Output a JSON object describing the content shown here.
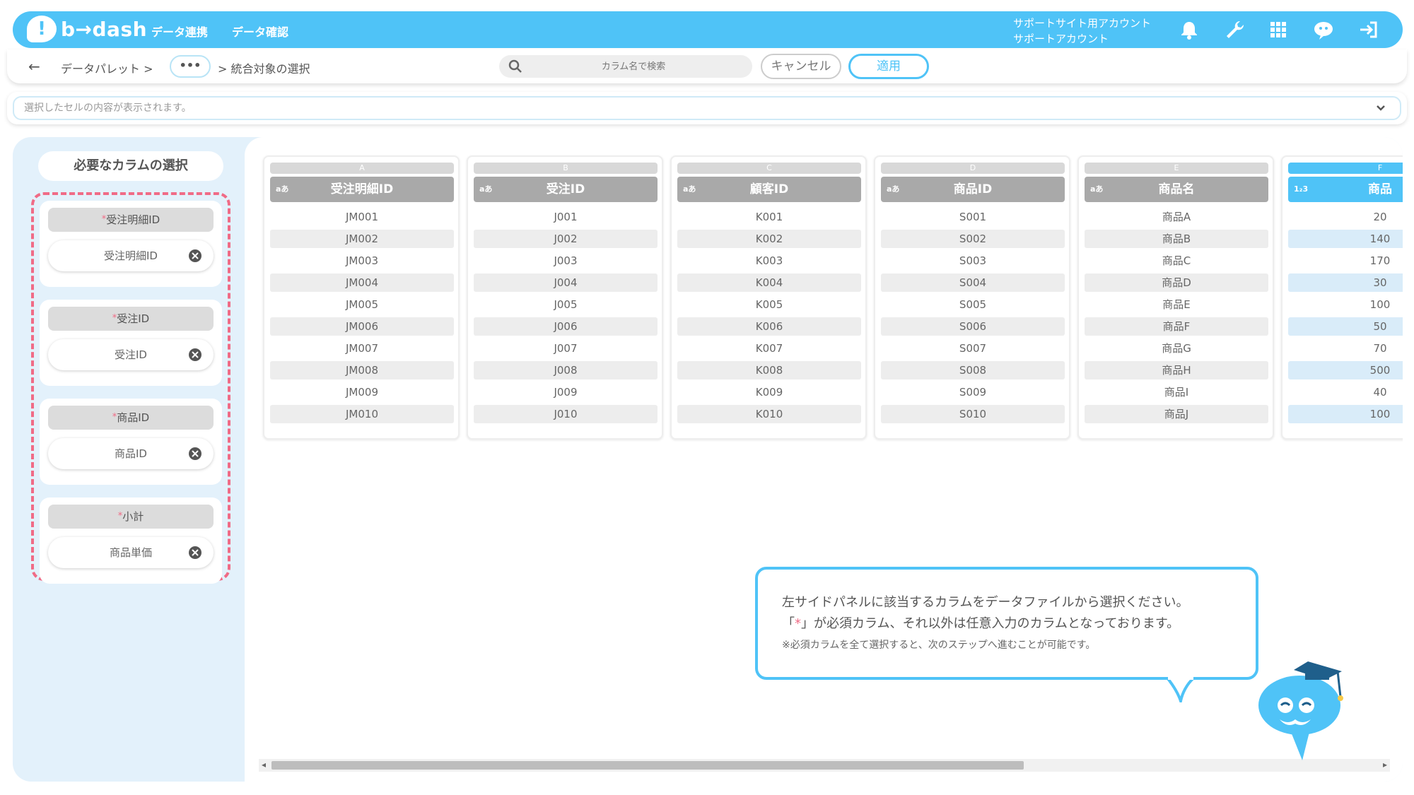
{
  "header": {
    "logo_text": "b→dash",
    "nav": [
      "データ連携",
      "データ確認"
    ],
    "account_line1": "サポートサイト用アカウント",
    "account_line2": "サポートアカウント",
    "icons": [
      "bell-icon",
      "wrench-icon",
      "apps-grid-icon",
      "chat-mascot-icon",
      "logout-icon"
    ]
  },
  "toolbar": {
    "back_icon": "←",
    "crumb1": "データパレット >",
    "more_label": "•••",
    "crumb2": "> 統合対象の選択",
    "search_placeholder": "カラム名で検索",
    "cancel_label": "キャンセル",
    "apply_label": "適用"
  },
  "cellbar": {
    "placeholder": "選択したセルの内容が表示されます。"
  },
  "panel": {
    "title": "必要なカラムの選択",
    "required_mark": "*",
    "cards": [
      {
        "label": "受注明細ID",
        "value": "受注明細ID"
      },
      {
        "label": "受注ID",
        "value": "受注ID"
      },
      {
        "label": "商品ID",
        "value": "商品ID"
      },
      {
        "label": "小計",
        "value": "商品単価"
      }
    ]
  },
  "columns": [
    {
      "letter": "A",
      "type": "aあ",
      "name": "受注明細ID",
      "values": [
        "JM001",
        "JM002",
        "JM003",
        "JM004",
        "JM005",
        "JM006",
        "JM007",
        "JM008",
        "JM009",
        "JM010"
      ]
    },
    {
      "letter": "B",
      "type": "aあ",
      "name": "受注ID",
      "values": [
        "J001",
        "J002",
        "J003",
        "J004",
        "J005",
        "J006",
        "J007",
        "J008",
        "J009",
        "J010"
      ]
    },
    {
      "letter": "C",
      "type": "aあ",
      "name": "顧客ID",
      "values": [
        "K001",
        "K002",
        "K003",
        "K004",
        "K005",
        "K006",
        "K007",
        "K008",
        "K009",
        "K010"
      ]
    },
    {
      "letter": "D",
      "type": "aあ",
      "name": "商品ID",
      "values": [
        "S001",
        "S002",
        "S003",
        "S004",
        "S005",
        "S006",
        "S007",
        "S008",
        "S009",
        "S010"
      ]
    },
    {
      "letter": "E",
      "type": "aあ",
      "name": "商品名",
      "values": [
        "商品A",
        "商品B",
        "商品C",
        "商品D",
        "商品E",
        "商品F",
        "商品G",
        "商品H",
        "商品I",
        "商品J"
      ]
    },
    {
      "letter": "F",
      "type": "1₂3",
      "name": "商品",
      "selected": true,
      "values": [
        "20",
        "140",
        "170",
        "30",
        "100",
        "50",
        "70",
        "500",
        "40",
        "100"
      ]
    }
  ],
  "tooltip": {
    "line1": "左サイドパネルに該当するカラムをデータファイルから選択ください。",
    "line2_pre": "「",
    "line2_star": "*",
    "line2_post": "」が必須カラム、それ以外は任意入力のカラムとなっております。",
    "line3": "※必須カラムを全て選択すると、次のステップへ進むことが可能です。"
  },
  "colors": {
    "brand": "#4fc3f7",
    "required": "#f06b86",
    "header_gray": "#a9a9a9"
  }
}
